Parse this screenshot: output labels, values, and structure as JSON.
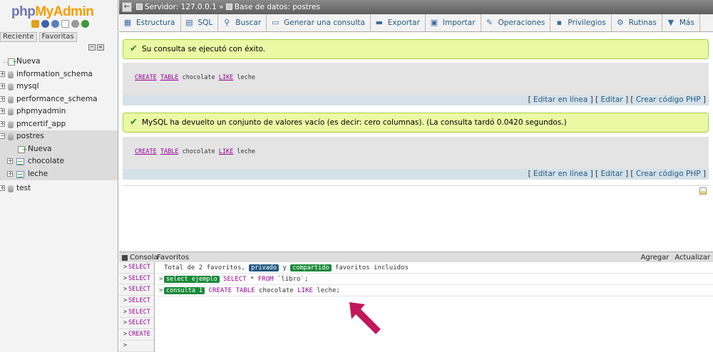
{
  "logo": {
    "part1": "php",
    "part2": "MyAdmin"
  },
  "sidebar": {
    "recent_tab": "Reciente",
    "favorites_tab": "Favoritas",
    "tree": [
      {
        "label": "Nueva",
        "type": "new"
      },
      {
        "label": "information_schema",
        "type": "db"
      },
      {
        "label": "mysql",
        "type": "db"
      },
      {
        "label": "performance_schema",
        "type": "db"
      },
      {
        "label": "phpmyadmin",
        "type": "db"
      },
      {
        "label": "pmcertif_app",
        "type": "db"
      }
    ],
    "selected_db": {
      "label": "postres",
      "children": [
        {
          "label": "Nueva",
          "type": "new"
        },
        {
          "label": "chocolate",
          "type": "table"
        },
        {
          "label": "leche",
          "type": "table"
        }
      ]
    },
    "after": [
      {
        "label": "test",
        "type": "db"
      }
    ]
  },
  "topbar": {
    "back": "←",
    "server": "Servidor: 127.0.0.1",
    "sep": "»",
    "database": "Base de datos: postres"
  },
  "tabs": [
    {
      "label": "Estructura",
      "icon": "structure-icon",
      "glyph": "▦"
    },
    {
      "label": "SQL",
      "icon": "sql-icon",
      "glyph": "▤"
    },
    {
      "label": "Buscar",
      "icon": "search-icon",
      "glyph": "⚲"
    },
    {
      "label": "Generar una consulta",
      "icon": "query-icon",
      "glyph": "▭"
    },
    {
      "label": "Exportar",
      "icon": "export-icon",
      "glyph": "▬"
    },
    {
      "label": "Importar",
      "icon": "import-icon",
      "glyph": "▣"
    },
    {
      "label": "Operaciones",
      "icon": "wrench-icon",
      "glyph": "✎"
    },
    {
      "label": "Privilegios",
      "icon": "privileges-icon",
      "glyph": "▪"
    },
    {
      "label": "Rutinas",
      "icon": "routines-icon",
      "glyph": "⚙"
    },
    {
      "label": "Más",
      "icon": "more-icon",
      "glyph": "▼"
    }
  ],
  "messages": [
    {
      "text": "Su consulta se ejecutó con éxito."
    },
    {
      "text": "MySQL ha devuelto un conjunto de valores vacío (es decir: cero columnas). (La consulta tardó 0.0420 segundos.)"
    }
  ],
  "sql": {
    "kw1": "CREATE",
    "kw2": "TABLE",
    "name1": "chocolate",
    "kw3": "LIKE",
    "name2": "leche"
  },
  "links": {
    "open": "[",
    "inline": "Editar en línea",
    "sep": "] [",
    "edit": "Editar",
    "php": "Crear código PHP",
    "close": "]"
  },
  "console": {
    "tab": "Consola",
    "favorites": "Favoritos",
    "add": "Agregar",
    "refresh": "Actualizar",
    "history": [
      "SELECT",
      "SELECT",
      "SELECT",
      "SELECT",
      "SELECT",
      "SELECT",
      "CREATE",
      ""
    ],
    "summary": {
      "pre": "Total de 2 favoritos,",
      "private": "privado",
      "mid": "y",
      "shared": "compartido",
      "post": "favoritos incluidos"
    },
    "fav1": {
      "name": "select ejemplo",
      "kw1": "SELECT",
      "star": "*",
      "kw2": "FROM",
      "rest": "`libro`;"
    },
    "fav2": {
      "name": "consulta 1",
      "kw1": "CREATE",
      "kw2": "TABLE",
      "name1": "chocolate",
      "kw3": "LIKE",
      "name2": "leche;"
    }
  },
  "colors": {
    "accent": "#235a81",
    "success_bg": "#ebf8a4",
    "keyword": "#990099",
    "arrow": "#c2185b"
  }
}
